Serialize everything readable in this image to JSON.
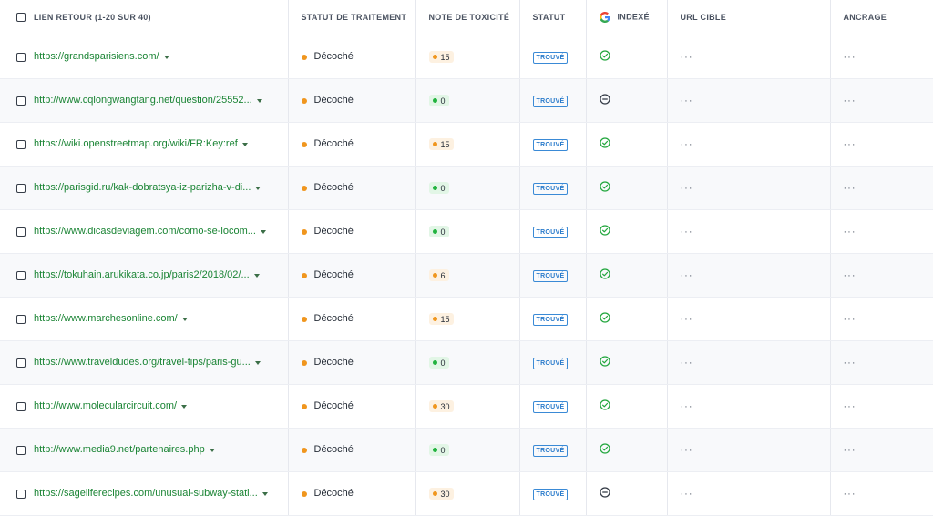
{
  "columns": {
    "backlink": "LIEN RETOUR (1-20 SUR 40)",
    "processing_status": "STATUT DE TRAITEMENT",
    "toxicity": "NOTE DE TOXICITÉ",
    "status": "STATUT",
    "indexed": "INDEXÉ",
    "target_url": "URL CIBLE",
    "anchor": "ANCRAGE"
  },
  "colors": {
    "link": "#1a8434",
    "status_dot": "#f0961e",
    "toxicity_high": "#f0961e",
    "toxicity_zero": "#22b33f",
    "badge": "#2a7bcb"
  },
  "rows": [
    {
      "url": "https://grandsparisiens.com/",
      "processing": "Décoché",
      "toxicity": "15",
      "tox_level": "orange",
      "status": "TROUVÉ",
      "indexed": "check-circle-icon",
      "target": "···",
      "anchor": "···"
    },
    {
      "url": "http://www.cqlongwangtang.net/question/25552...",
      "processing": "Décoché",
      "toxicity": "0",
      "tox_level": "green",
      "status": "TROUVÉ",
      "indexed": "minus-circle-icon",
      "target": "···",
      "anchor": "···"
    },
    {
      "url": "https://wiki.openstreetmap.org/wiki/FR:Key:ref",
      "processing": "Décoché",
      "toxicity": "15",
      "tox_level": "orange",
      "status": "TROUVÉ",
      "indexed": "check-circle-icon",
      "target": "···",
      "anchor": "···"
    },
    {
      "url": "https://parisgid.ru/kak-dobratsya-iz-parizha-v-di...",
      "processing": "Décoché",
      "toxicity": "0",
      "tox_level": "green",
      "status": "TROUVÉ",
      "indexed": "check-circle-icon",
      "target": "···",
      "anchor": "···"
    },
    {
      "url": "https://www.dicasdeviagem.com/como-se-locom...",
      "processing": "Décoché",
      "toxicity": "0",
      "tox_level": "green",
      "status": "TROUVÉ",
      "indexed": "check-circle-icon",
      "target": "···",
      "anchor": "···"
    },
    {
      "url": "https://tokuhain.arukikata.co.jp/paris2/2018/02/...",
      "processing": "Décoché",
      "toxicity": "6",
      "tox_level": "orange",
      "status": "TROUVÉ",
      "indexed": "check-circle-icon",
      "target": "···",
      "anchor": "···"
    },
    {
      "url": "https://www.marchesonline.com/",
      "processing": "Décoché",
      "toxicity": "15",
      "tox_level": "orange",
      "status": "TROUVÉ",
      "indexed": "check-circle-icon",
      "target": "···",
      "anchor": "···"
    },
    {
      "url": "https://www.traveldudes.org/travel-tips/paris-gu...",
      "processing": "Décoché",
      "toxicity": "0",
      "tox_level": "green",
      "status": "TROUVÉ",
      "indexed": "check-circle-icon",
      "target": "···",
      "anchor": "···"
    },
    {
      "url": "http://www.molecularcircuit.com/",
      "processing": "Décoché",
      "toxicity": "30",
      "tox_level": "orange",
      "status": "TROUVÉ",
      "indexed": "check-circle-icon",
      "target": "···",
      "anchor": "···"
    },
    {
      "url": "http://www.media9.net/partenaires.php",
      "processing": "Décoché",
      "toxicity": "0",
      "tox_level": "green",
      "status": "TROUVÉ",
      "indexed": "check-circle-icon",
      "target": "···",
      "anchor": "···"
    },
    {
      "url": "https://sageliferecipes.com/unusual-subway-stati...",
      "processing": "Décoché",
      "toxicity": "30",
      "tox_level": "orange",
      "status": "TROUVÉ",
      "indexed": "minus-circle-icon",
      "target": "···",
      "anchor": "···"
    }
  ]
}
